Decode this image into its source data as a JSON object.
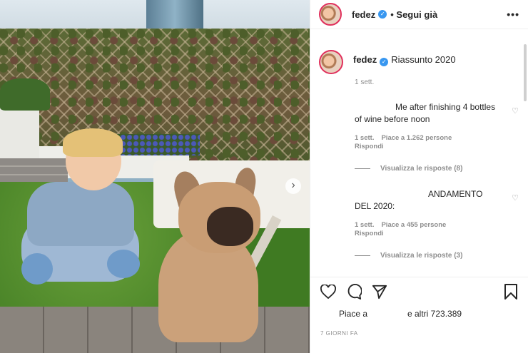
{
  "post": {
    "username": "fedez",
    "follow_label": "• Segui già",
    "more_label": "•••"
  },
  "caption": {
    "username": "fedez",
    "text": "Riassunto 2020",
    "time": "1 sett."
  },
  "comments": [
    {
      "text": "Me after finishing 4 bottles of wine before noon",
      "time": "1 sett.",
      "likes": "Piace a 1.262 persone",
      "reply": "Rispondi",
      "view_replies": "Visualizza le risposte (8)"
    },
    {
      "text": "ANDAMENTO DEL 2020:",
      "time": "1 sett.",
      "likes": "Piace a 455 persone",
      "reply": "Rispondi",
      "view_replies": "Visualizza le risposte (3)"
    }
  ],
  "likes": {
    "prefix": "Piace a",
    "suffix": "e altri 723.389"
  },
  "time_ago": "7 GIORNI FA",
  "icons": {
    "next": "›"
  }
}
